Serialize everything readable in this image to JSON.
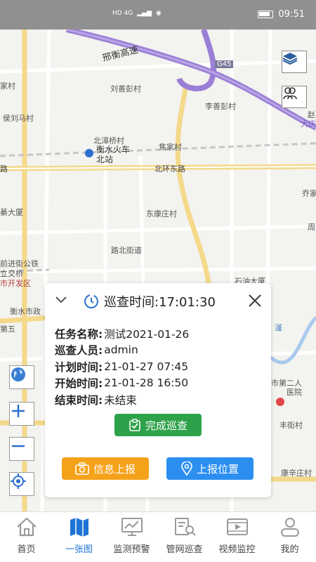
{
  "status_bar": {
    "left_indicators": "HD 4G",
    "time": "09:51"
  },
  "map": {
    "labels": {
      "highway": "邢衡高速",
      "highway_code": "G45",
      "village1": "刘善彭村",
      "village2": "李善彭村",
      "village3": "侯刘马村",
      "village4": "北漳桥村",
      "station1": "衡水火车",
      "station2": "北站",
      "village5": "焦家村",
      "road1": "北环东路",
      "road1b": "路",
      "village6": "东康庄村",
      "street1": "路北街道",
      "left1": "家村",
      "left2": "綦大厦",
      "left3": "前进街公铁",
      "left4": "立交桥",
      "left5": "市开发区",
      "left6": "衡水市政",
      "left7": "第五",
      "right1": "赵",
      "right2": "大庆",
      "right3": "乔家",
      "right4": "周",
      "right5": "石油大厦",
      "right6": "市第二人",
      "right7": "医院",
      "right8": "丰街村",
      "right9": "康辛庄村",
      "river": "滏"
    }
  },
  "card": {
    "title": "巡查时间:17:01:30",
    "rows": [
      {
        "key": "任务名称:",
        "value": "测试2021-01-26"
      },
      {
        "key": "巡查人员:",
        "value": "admin"
      },
      {
        "key": "计划时间:",
        "value": "21-01-27 07:45"
      },
      {
        "key": "开始时间:",
        "value": "21-01-28 16:50"
      },
      {
        "key": "结束时间:",
        "value": "未结束"
      }
    ],
    "done_label": "完成巡查",
    "report_label": "信息上报",
    "location_label": "上报位置"
  },
  "tabs": [
    {
      "label": "首页",
      "icon": "home-icon"
    },
    {
      "label": "一张图",
      "icon": "map-icon"
    },
    {
      "label": "监测预警",
      "icon": "monitor-icon"
    },
    {
      "label": "管网巡查",
      "icon": "inspection-icon"
    },
    {
      "label": "视频监控",
      "icon": "video-icon"
    },
    {
      "label": "我的",
      "icon": "user-icon"
    }
  ],
  "colors": {
    "active_tab": "#1e73d6",
    "done_button": "#2ea24b",
    "report_button": "#f5a21b",
    "location_button": "#2c8ff0",
    "highway": "#9b7fd6"
  }
}
